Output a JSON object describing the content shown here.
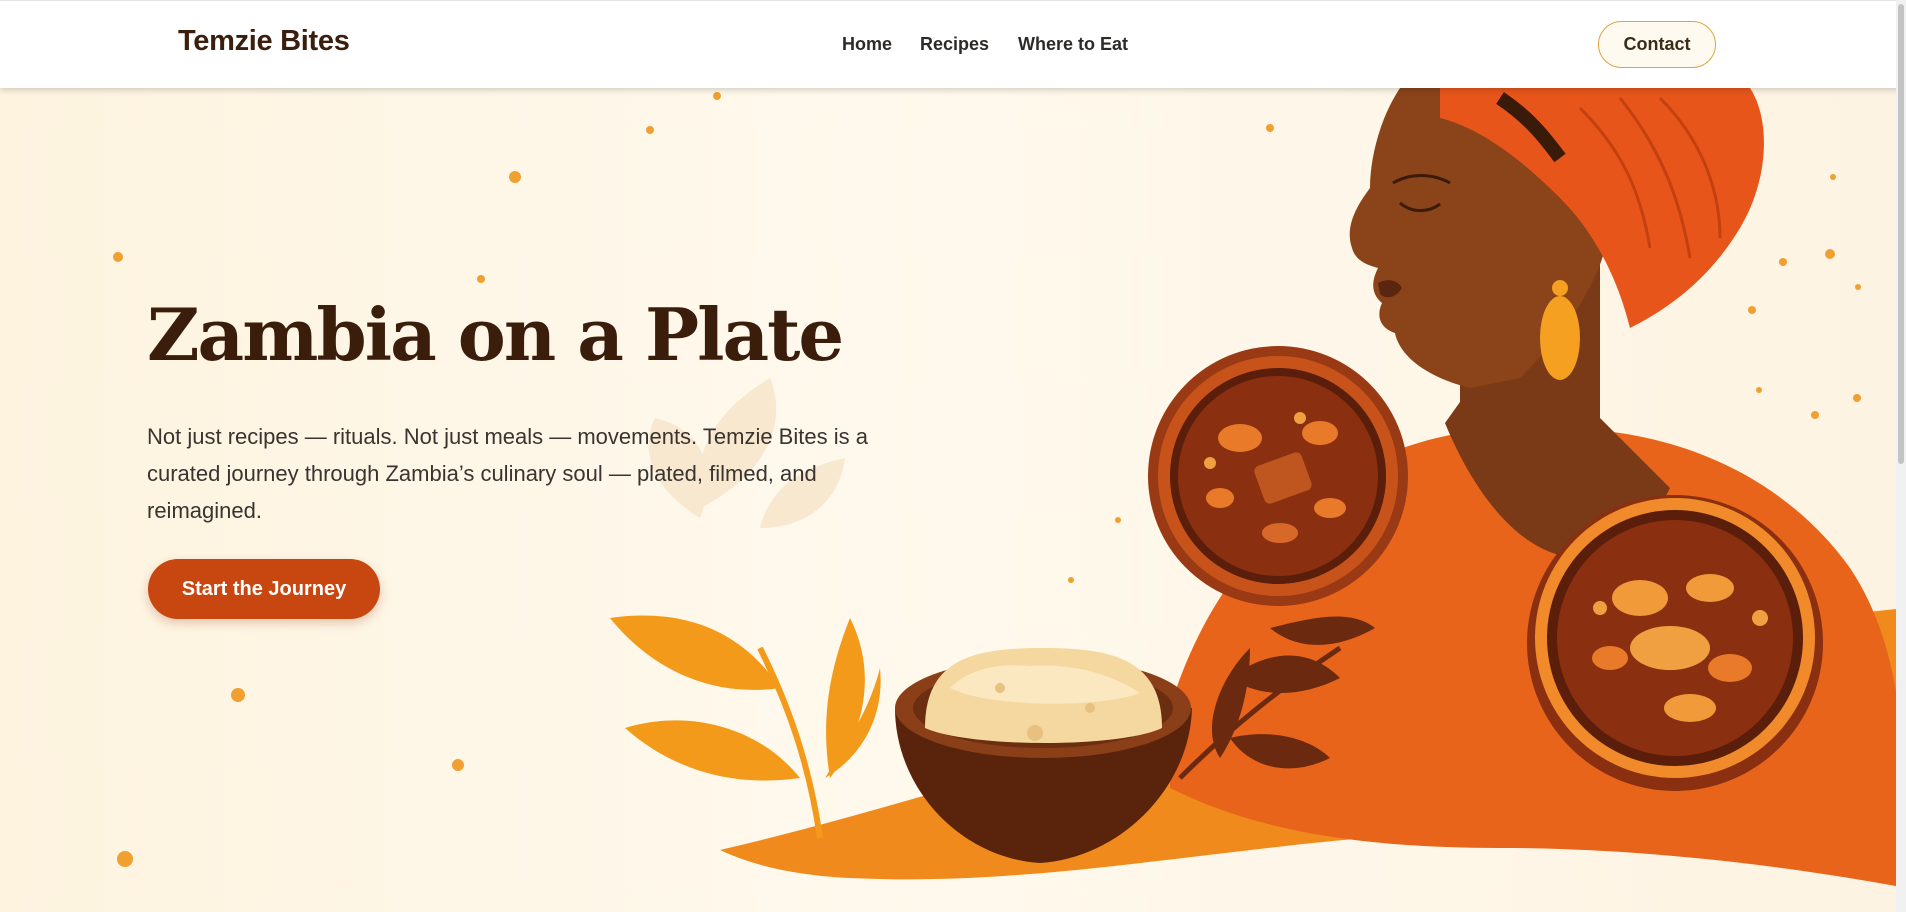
{
  "nav": {
    "brand": "Temzie Bites",
    "links": [
      "Home",
      "Recipes",
      "Where to Eat"
    ],
    "contact_label": "Contact"
  },
  "hero": {
    "title": "Zambia on a Plate",
    "description": "Not just recipes — rituals. Not just meals — movements. Temzie Bites is a curated journey through Zambia’s culinary soul — plated, filmed, and reimagined.",
    "cta_label": "Start the Journey"
  },
  "colors": {
    "brand_dark": "#3a1d0b",
    "accent_orange": "#c8460f",
    "background_cream": "#fdf6e8",
    "contact_border": "#e0a33b"
  },
  "icons": {
    "illustration": "woman-with-zambian-dishes-illustration"
  }
}
